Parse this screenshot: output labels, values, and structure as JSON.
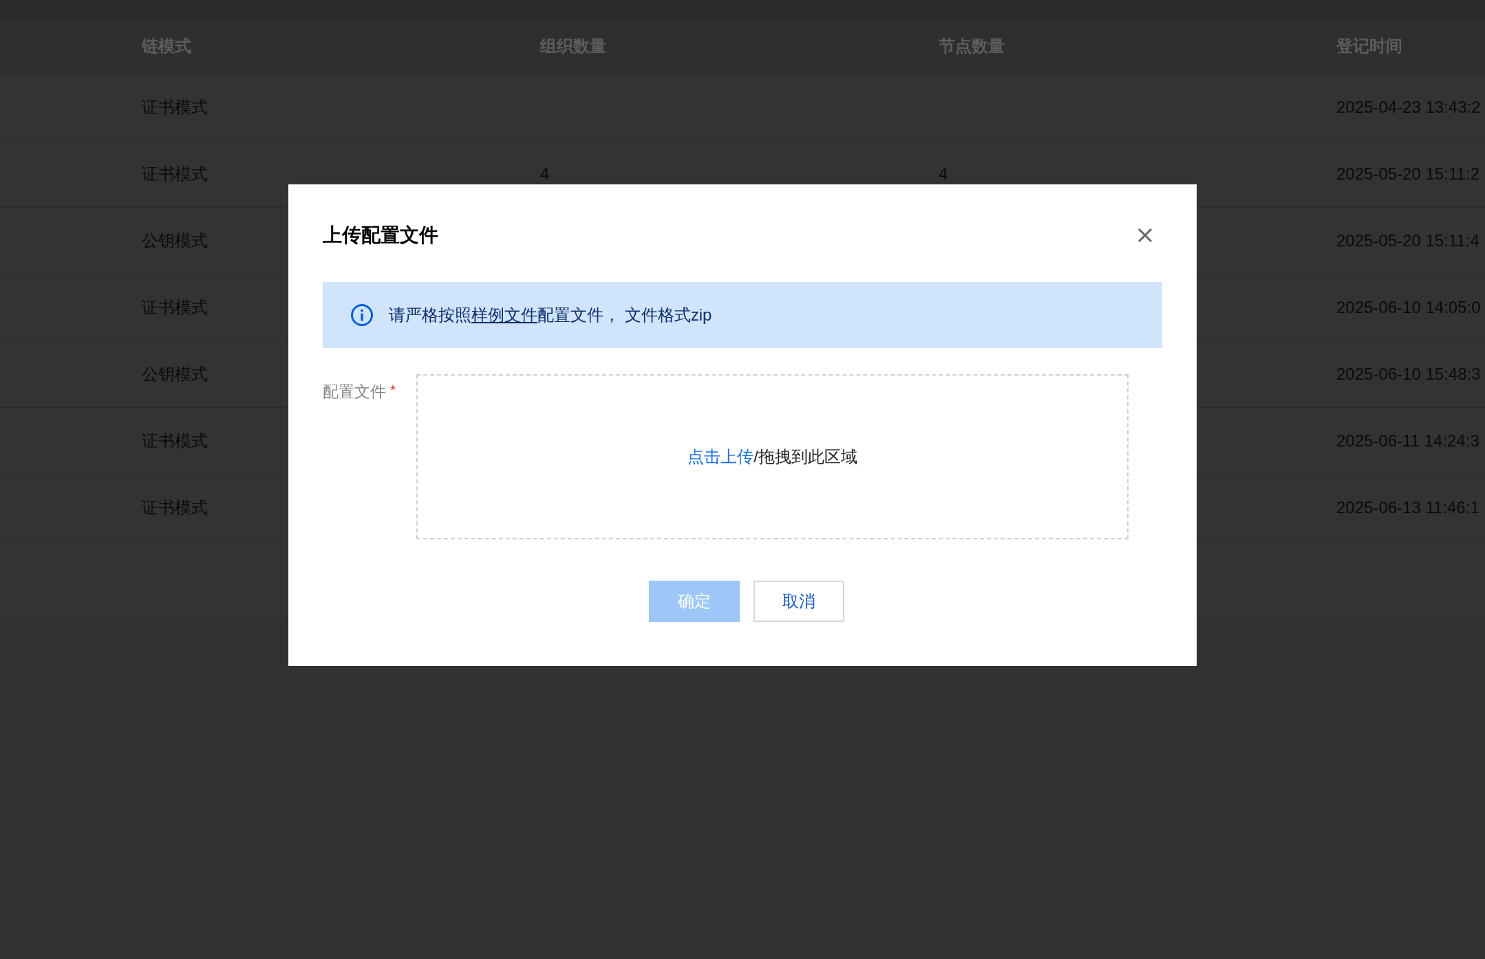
{
  "table": {
    "columns": [
      "链模式",
      "组织数量",
      "节点数量",
      "登记时间"
    ],
    "rows": [
      {
        "cells": [
          "证书模式",
          "",
          "",
          "2025-04-23 13:43:2"
        ]
      },
      {
        "cells": [
          "证书模式",
          "4",
          "4",
          "2025-05-20 15:11:2"
        ]
      },
      {
        "cells": [
          "公钥模式",
          null,
          null,
          "2025-05-20 15:11:4"
        ]
      },
      {
        "cells": [
          "证书模式",
          null,
          null,
          "2025-06-10 14:05:0"
        ]
      },
      {
        "cells": [
          "公钥模式",
          null,
          null,
          "2025-06-10 15:48:3"
        ]
      },
      {
        "cells": [
          "证书模式",
          null,
          null,
          "2025-06-11 14:24:3"
        ]
      },
      {
        "cells": [
          "证书模式",
          null,
          null,
          "2025-06-13 11:46:1"
        ]
      }
    ]
  },
  "dialog": {
    "title": "上传配置文件",
    "notice": {
      "text_before": "请严格按照",
      "link": "样例文件",
      "text_after": "配置文件， 文件格式zip"
    },
    "field": {
      "label": "配置文件",
      "required_mark": "*",
      "upload_link": "点击上传",
      "upload_text": "/拖拽到此区域"
    },
    "buttons": [
      {
        "label": "确定",
        "kind": "primary",
        "disabled": true
      },
      {
        "label": "取消",
        "kind": "secondary",
        "disabled": false
      }
    ]
  }
}
